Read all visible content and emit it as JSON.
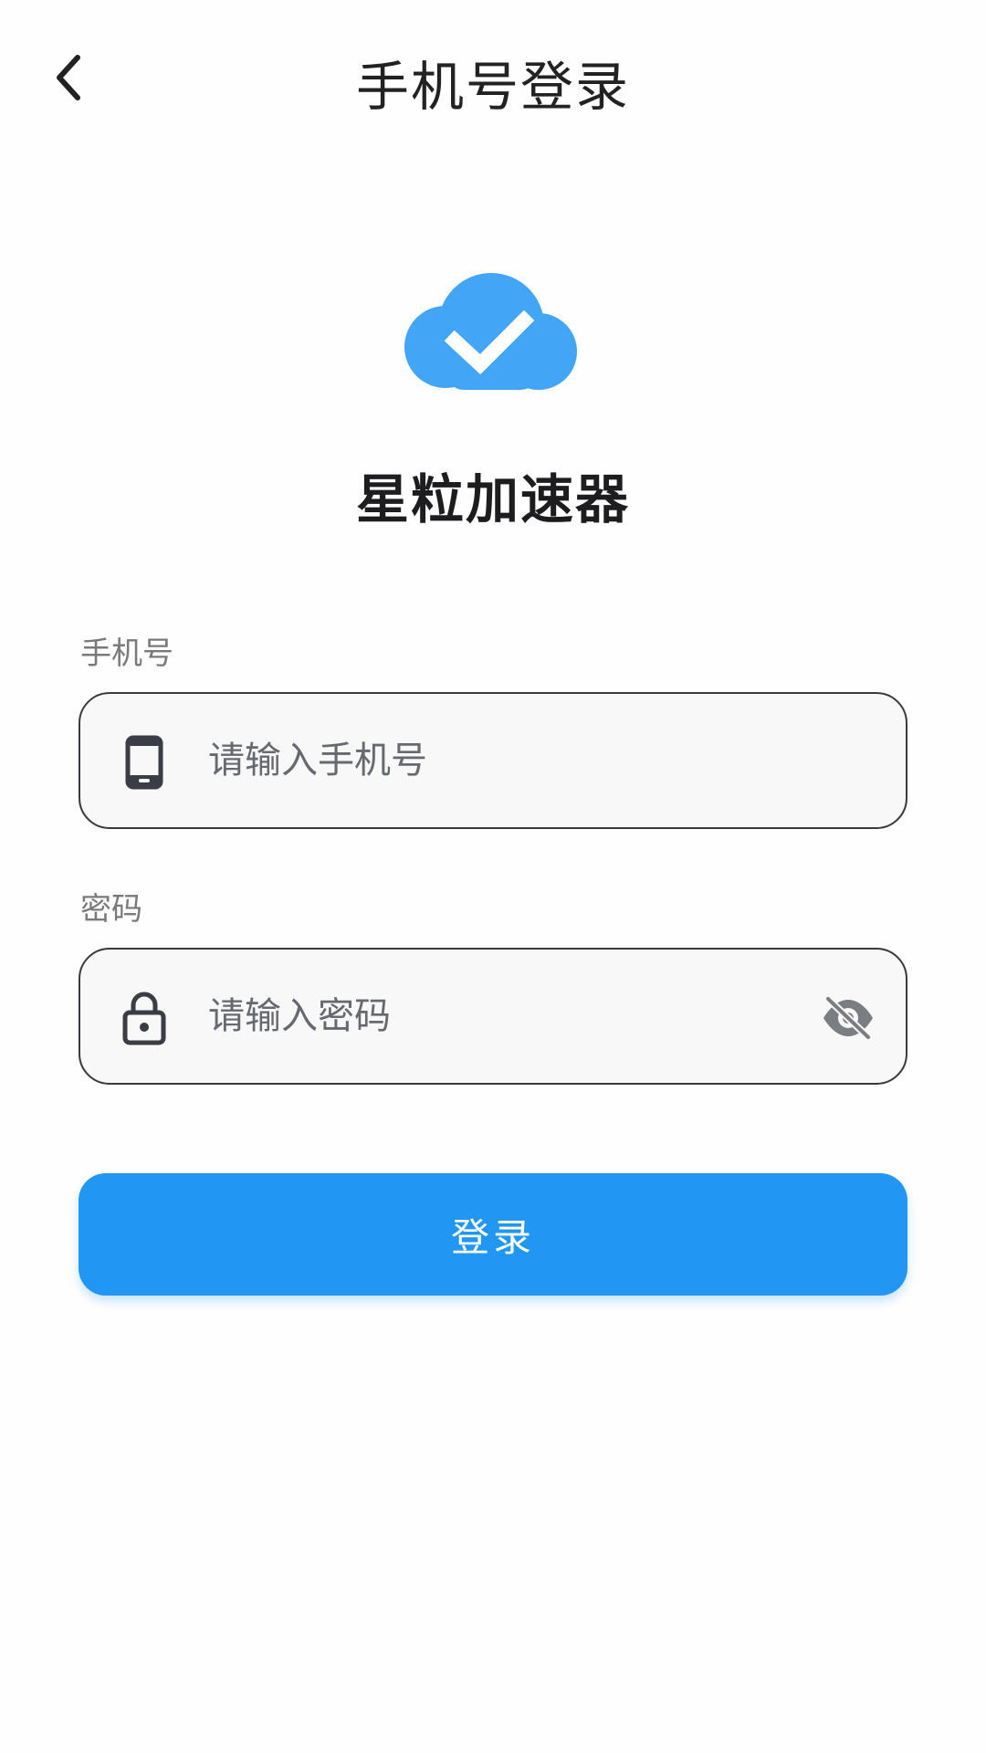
{
  "header": {
    "title": "手机号登录",
    "back_icon": "chevron-left-icon"
  },
  "brand": {
    "logo_icon": "cloud-check-icon",
    "logo_color": "#42a5f5",
    "name": "星粒加速器"
  },
  "form": {
    "phone": {
      "label": "手机号",
      "placeholder": "请输入手机号",
      "value": "",
      "icon": "smartphone-icon"
    },
    "password": {
      "label": "密码",
      "placeholder": "请输入密码",
      "value": "",
      "icon": "lock-icon",
      "visibility_icon": "eye-off-icon"
    },
    "submit_label": "登录"
  },
  "colors": {
    "accent": "#2196f3",
    "text_primary": "#222222",
    "label": "#7a7a7a",
    "input_border": "#3a3a3e",
    "input_bg": "#f8f8f8"
  }
}
